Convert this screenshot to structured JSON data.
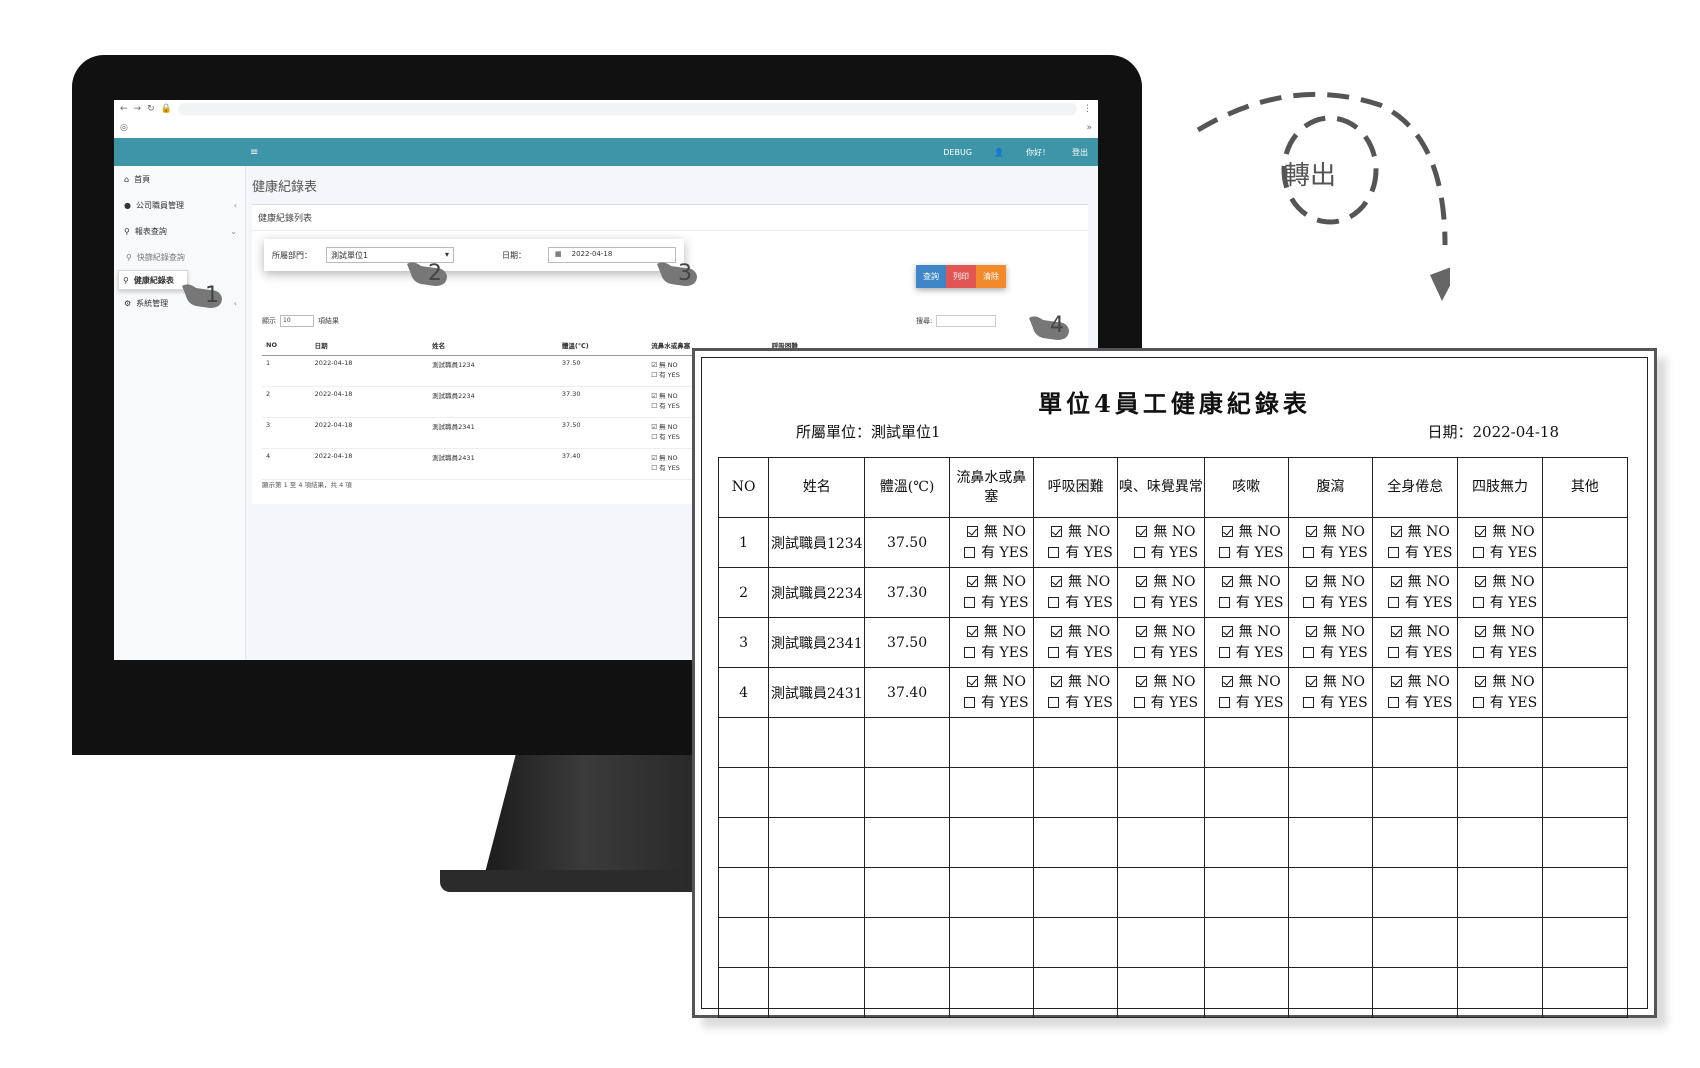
{
  "browser": {
    "address_icon": "lock-icon"
  },
  "app": {
    "header": {
      "debug_label": "DEBUG",
      "greeting": "你好！",
      "logout_label": "登出"
    },
    "sidebar": {
      "items": [
        {
          "label": "首頁",
          "icon": "home-icon"
        },
        {
          "label": "公司職員管理",
          "icon": "user-icon"
        },
        {
          "label": "報表查詢",
          "icon": "search-icon"
        },
        {
          "label": "快篩紀錄查詢",
          "icon": "search-icon"
        },
        {
          "label": "健康紀錄表",
          "icon": "search-icon"
        },
        {
          "label": "系統管理",
          "icon": "gear-icon"
        }
      ]
    },
    "page_title": "健康紀錄表",
    "card_title": "健康紀錄列表",
    "filter": {
      "dept_label": "所屬部門：",
      "dept_value": "測試單位1",
      "date_label": "日期：",
      "date_value": "2022-04-18"
    },
    "buttons": {
      "query": "查詢",
      "print": "列印",
      "clear": "清除"
    },
    "list_controls": {
      "show_prefix": "顯示",
      "page_size": "10",
      "show_suffix": "項結果",
      "search_label": "搜尋:"
    },
    "table": {
      "headers": [
        "NO",
        "日期",
        "姓名",
        "體溫(℃)",
        "流鼻水或鼻塞",
        "呼吸困難"
      ],
      "rows": [
        {
          "no": "1",
          "date": "2022-04-18",
          "name": "測試職員1234",
          "temp": "37.50"
        },
        {
          "no": "2",
          "date": "2022-04-18",
          "name": "測試職員2234",
          "temp": "37.30"
        },
        {
          "no": "3",
          "date": "2022-04-18",
          "name": "測試職員2341",
          "temp": "37.50"
        },
        {
          "no": "4",
          "date": "2022-04-18",
          "name": "測試職員2431",
          "temp": "37.40"
        }
      ],
      "opt_no": "無 NO",
      "opt_yes": "有 YES",
      "footer": "顯示第 1 至 4 項結果，共 4 項"
    }
  },
  "annotations": {
    "step1": "1",
    "step2": "2",
    "step3": "3",
    "step4": "4",
    "transfer_label": "轉出"
  },
  "report": {
    "title": "單位4員工健康紀錄表",
    "unit_label": "所屬單位：測試單位1",
    "date_label": "日期：2022-04-18",
    "headers": [
      "NO",
      "姓名",
      "體溫(℃)",
      "流鼻水或鼻塞",
      "呼吸困難",
      "嗅、味覺異常",
      "咳嗽",
      "腹瀉",
      "全身倦怠",
      "四肢無力",
      "其他"
    ],
    "rows": [
      {
        "no": "1",
        "name": "測試職員1234",
        "temp": "37.50"
      },
      {
        "no": "2",
        "name": "測試職員2234",
        "temp": "37.30"
      },
      {
        "no": "3",
        "name": "測試職員2341",
        "temp": "37.50"
      },
      {
        "no": "4",
        "name": "測試職員2431",
        "temp": "37.40"
      }
    ],
    "opt_no": "無 NO",
    "opt_yes": "有 YES"
  }
}
